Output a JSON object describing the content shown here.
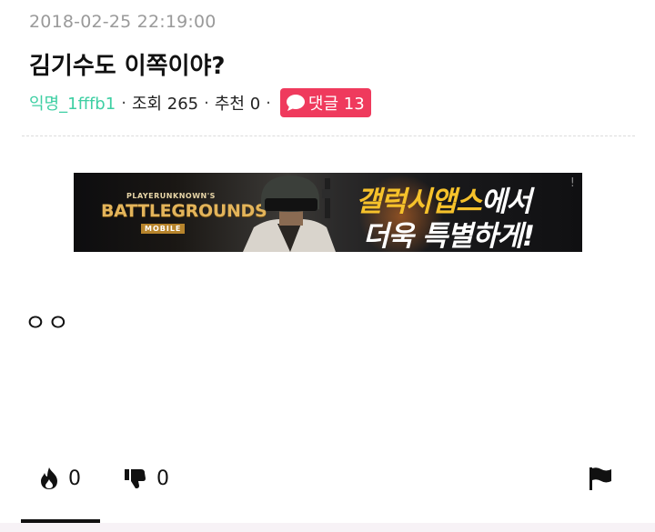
{
  "post": {
    "timestamp": "2018-02-25 22:19:00",
    "title": "김기수도 이쪽이야?",
    "author": "익명_1fffb1",
    "separator": "·",
    "views_label": "조회 265",
    "recommend_label": "추천 0",
    "comments_label": "댓글 13",
    "body": "ㅇㅇ"
  },
  "banner": {
    "logo_top": "PLAYERUNKNOWN'S",
    "logo_main": "BATTLEGROUNDS",
    "logo_sub": "MOBILE",
    "promo_line1_a": "갤럭시앱스",
    "promo_line1_b": "에서",
    "promo_line2": "더욱 특별하게!",
    "ad_marker": "!"
  },
  "actions": {
    "like_count": "0",
    "dislike_count": "0"
  },
  "icons": {
    "comment": "speech-bubble-icon",
    "like": "fire-icon",
    "dislike": "thumbs-down-icon",
    "report": "flag-icon"
  },
  "colors": {
    "author": "#3ecfa3",
    "comment_badge": "#ef3a5d",
    "timestamp": "#9a9a9a"
  }
}
